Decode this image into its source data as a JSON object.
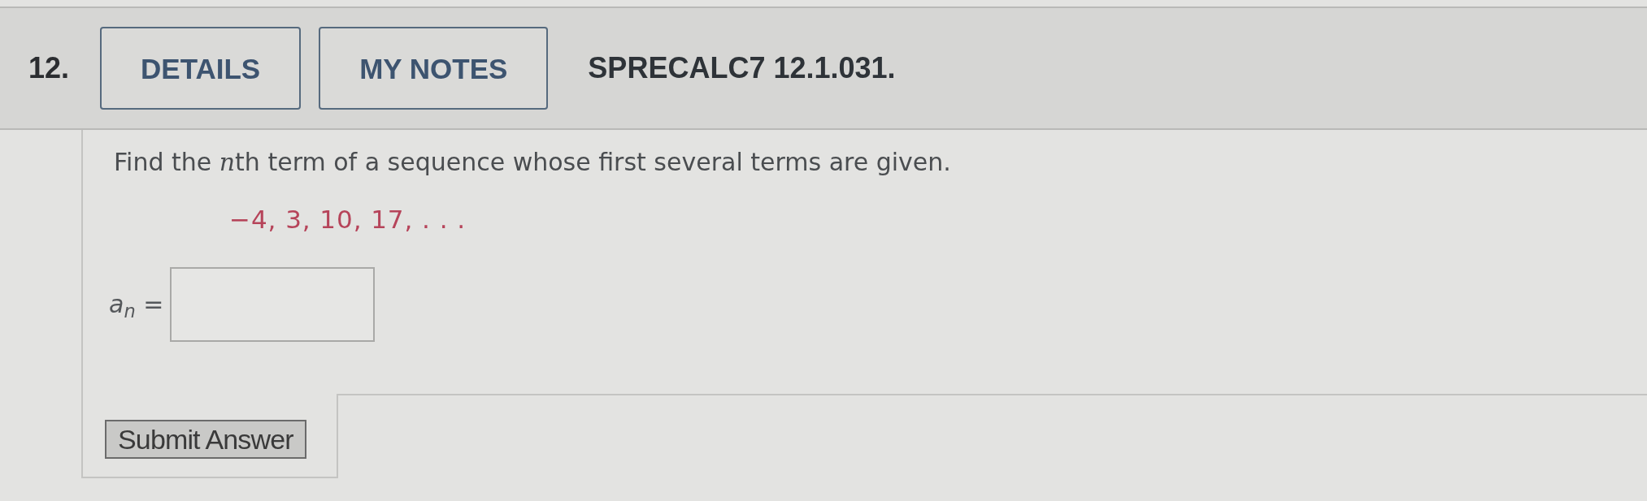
{
  "header": {
    "number": "12.",
    "buttons": [
      {
        "label": "DETAILS"
      },
      {
        "label": "MY NOTES"
      }
    ],
    "code": "SPRECALC7 12.1.031."
  },
  "question": {
    "prompt": [
      {
        "kind": "text",
        "text": "Find the "
      },
      {
        "kind": "variable",
        "text": "n"
      },
      {
        "kind": "text",
        "text": "th term of a sequence whose first several terms are given."
      }
    ],
    "sequence": "−4, 3, 10, 17, . . .",
    "answer_label": "*a*$_{n}$ ="
  },
  "submit": {
    "label": "Submit Answer"
  }
}
